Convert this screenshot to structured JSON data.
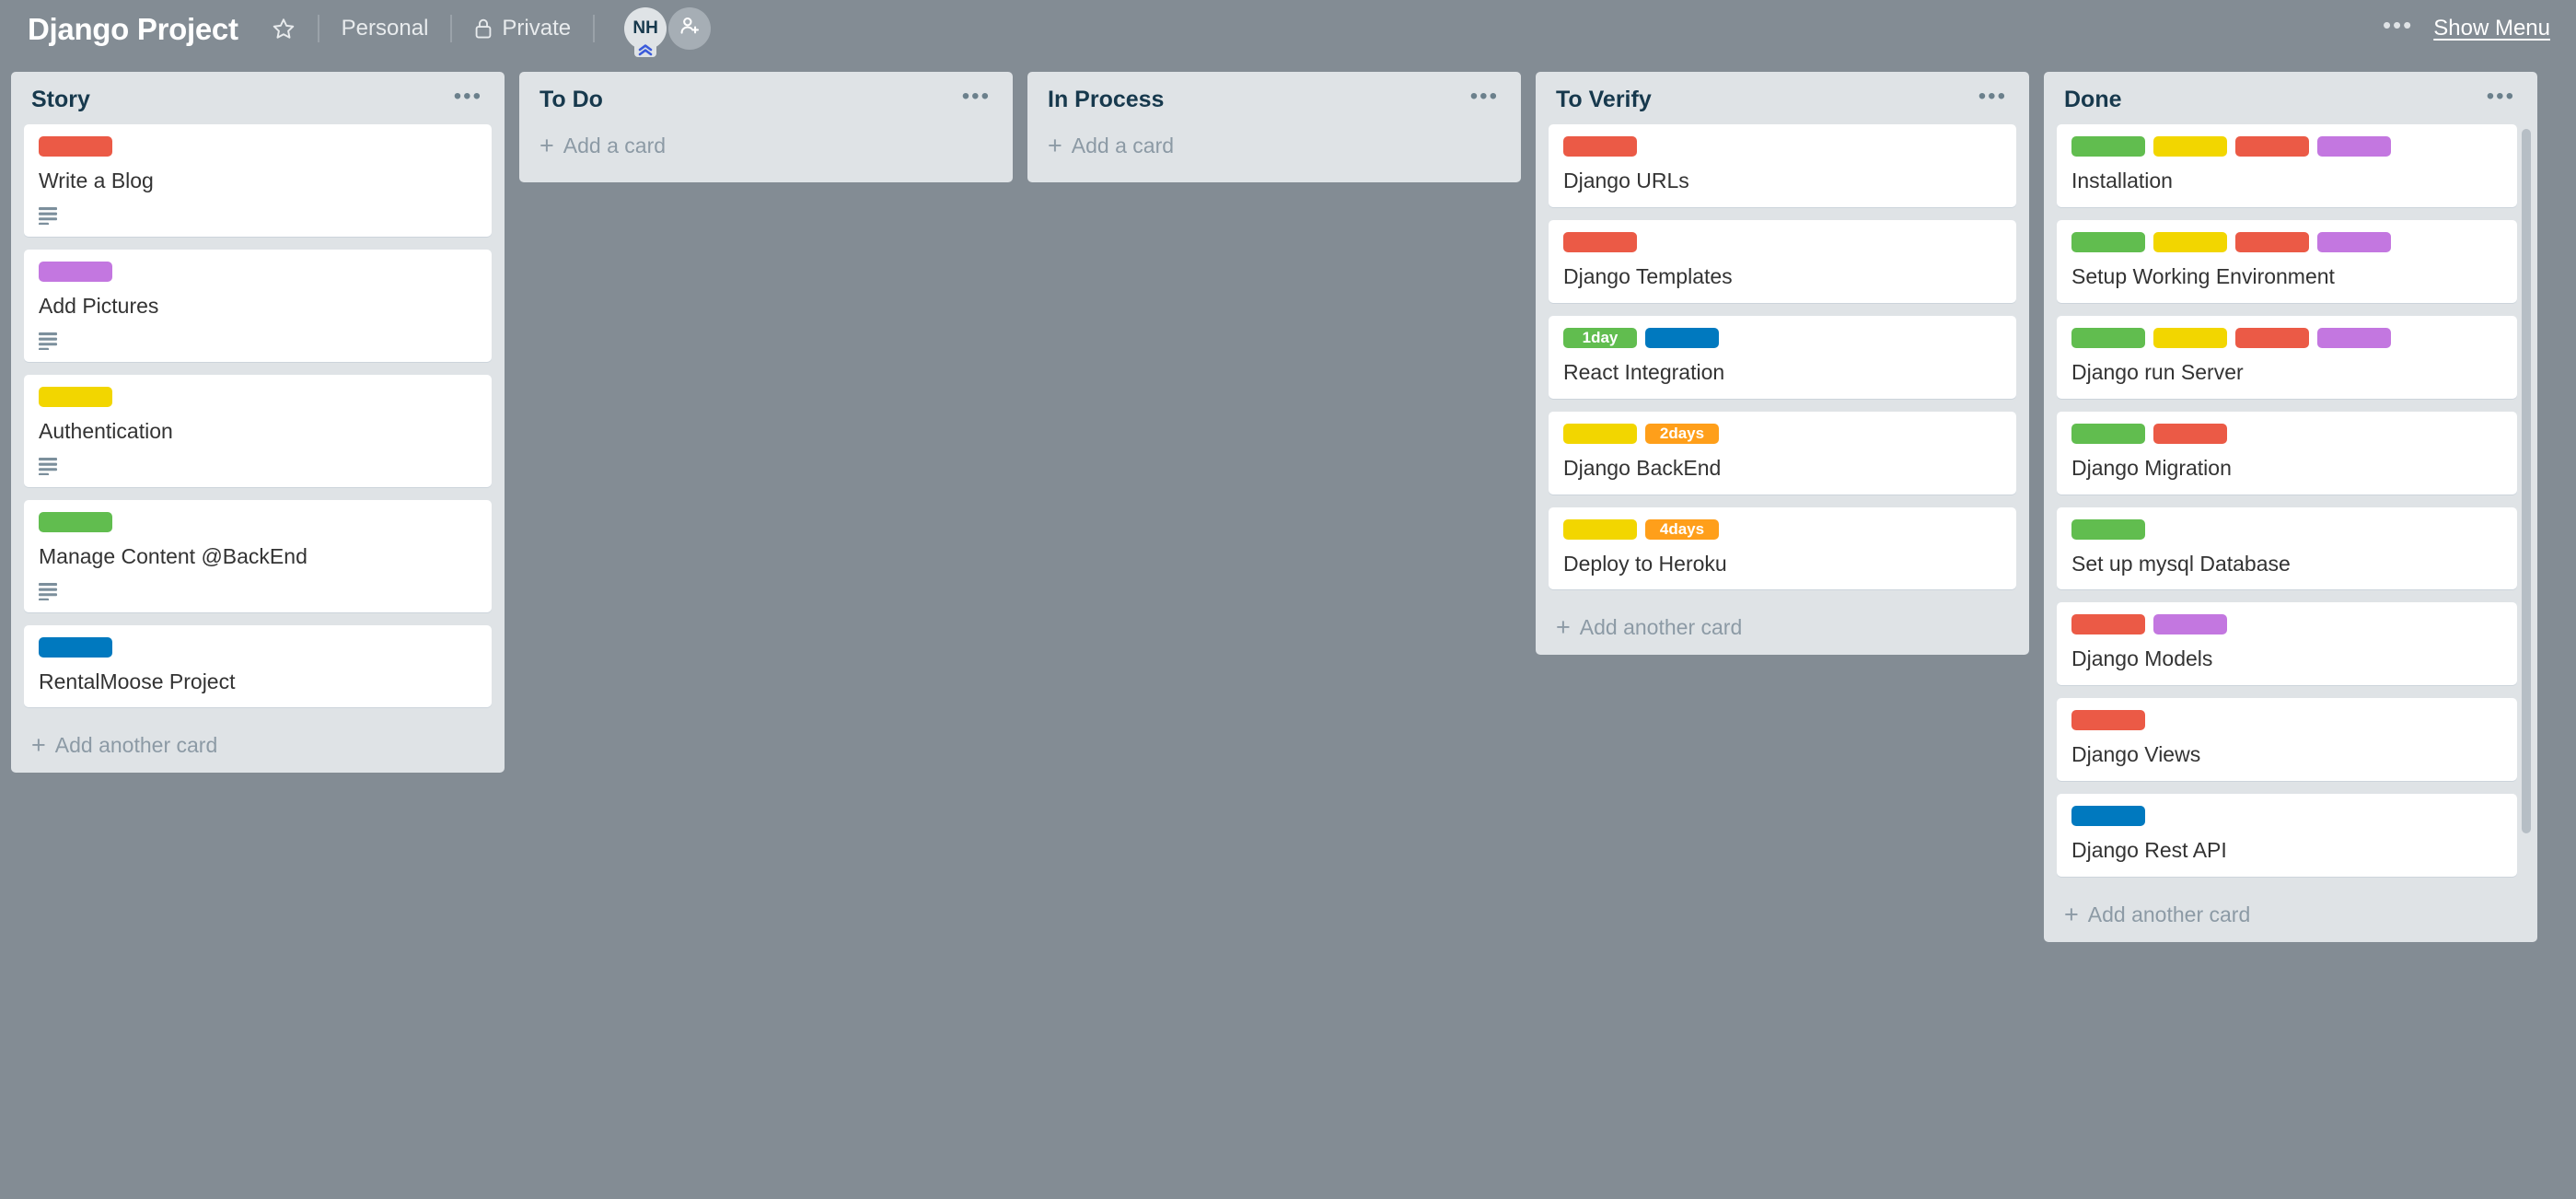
{
  "header": {
    "board_title": "Django Project",
    "star_icon": "star-icon",
    "workspace_label": "Personal",
    "visibility_label": "Private",
    "lock_icon": "lock-icon",
    "members": [
      {
        "initials": "NH",
        "type": "user-avatar"
      },
      {
        "initials": "",
        "type": "add-member-avatar"
      }
    ],
    "more_icon": "ellipsis-icon",
    "show_menu_label": "Show Menu"
  },
  "colors": {
    "board_background": "#838c94",
    "list_background": "#dfe3e6",
    "card_background": "#ffffff",
    "title_text": "#17394d",
    "label_green": "#61bd4f",
    "label_yellow": "#f2d600",
    "label_orange": "#ff9f1a",
    "label_red": "#eb5a46",
    "label_purple": "#c377e0",
    "label_blue": "#0079bf"
  },
  "lists": [
    {
      "title": "Story",
      "menu_icon": "ellipsis-icon",
      "add_label": "Add another card",
      "scrollable": false,
      "cards": [
        {
          "title": "Write a Blog",
          "has_description": true,
          "labels": [
            {
              "color": "#eb5a46",
              "text": ""
            }
          ]
        },
        {
          "title": "Add Pictures",
          "has_description": true,
          "labels": [
            {
              "color": "#c377e0",
              "text": ""
            }
          ]
        },
        {
          "title": "Authentication",
          "has_description": true,
          "labels": [
            {
              "color": "#f2d600",
              "text": ""
            }
          ]
        },
        {
          "title": "Manage Content @BackEnd",
          "has_description": true,
          "labels": [
            {
              "color": "#61bd4f",
              "text": ""
            }
          ]
        },
        {
          "title": "RentalMoose Project",
          "has_description": false,
          "labels": [
            {
              "color": "#0079bf",
              "text": ""
            }
          ]
        }
      ]
    },
    {
      "title": "To Do",
      "menu_icon": "ellipsis-icon",
      "add_label": "Add a card",
      "scrollable": false,
      "cards": []
    },
    {
      "title": "In Process",
      "menu_icon": "ellipsis-icon",
      "add_label": "Add a card",
      "scrollable": false,
      "cards": []
    },
    {
      "title": "To Verify",
      "menu_icon": "ellipsis-icon",
      "add_label": "Add another card",
      "scrollable": false,
      "cards": [
        {
          "title": "Django URLs",
          "has_description": false,
          "labels": [
            {
              "color": "#eb5a46",
              "text": ""
            }
          ]
        },
        {
          "title": "Django Templates",
          "has_description": false,
          "labels": [
            {
              "color": "#eb5a46",
              "text": ""
            }
          ]
        },
        {
          "title": "React Integration",
          "has_description": false,
          "labels": [
            {
              "color": "#61bd4f",
              "text": "1day"
            },
            {
              "color": "#0079bf",
              "text": ""
            }
          ]
        },
        {
          "title": "Django BackEnd",
          "has_description": false,
          "labels": [
            {
              "color": "#f2d600",
              "text": ""
            },
            {
              "color": "#ff9f1a",
              "text": "2days"
            }
          ]
        },
        {
          "title": "Deploy to Heroku",
          "has_description": false,
          "labels": [
            {
              "color": "#f2d600",
              "text": ""
            },
            {
              "color": "#ff9f1a",
              "text": "4days"
            }
          ]
        }
      ]
    },
    {
      "title": "Done",
      "menu_icon": "ellipsis-icon",
      "add_label": "Add another card",
      "scrollable": true,
      "cards": [
        {
          "title": "Installation",
          "has_description": false,
          "labels": [
            {
              "color": "#61bd4f",
              "text": ""
            },
            {
              "color": "#f2d600",
              "text": ""
            },
            {
              "color": "#eb5a46",
              "text": ""
            },
            {
              "color": "#c377e0",
              "text": ""
            }
          ]
        },
        {
          "title": "Setup Working Environment",
          "has_description": false,
          "labels": [
            {
              "color": "#61bd4f",
              "text": ""
            },
            {
              "color": "#f2d600",
              "text": ""
            },
            {
              "color": "#eb5a46",
              "text": ""
            },
            {
              "color": "#c377e0",
              "text": ""
            }
          ]
        },
        {
          "title": "Django run Server",
          "has_description": false,
          "labels": [
            {
              "color": "#61bd4f",
              "text": ""
            },
            {
              "color": "#f2d600",
              "text": ""
            },
            {
              "color": "#eb5a46",
              "text": ""
            },
            {
              "color": "#c377e0",
              "text": ""
            }
          ]
        },
        {
          "title": "Django Migration",
          "has_description": false,
          "labels": [
            {
              "color": "#61bd4f",
              "text": ""
            },
            {
              "color": "#eb5a46",
              "text": ""
            }
          ]
        },
        {
          "title": "Set up mysql Database",
          "has_description": false,
          "labels": [
            {
              "color": "#61bd4f",
              "text": ""
            }
          ]
        },
        {
          "title": "Django Models",
          "has_description": false,
          "labels": [
            {
              "color": "#eb5a46",
              "text": ""
            },
            {
              "color": "#c377e0",
              "text": ""
            }
          ]
        },
        {
          "title": "Django Views",
          "has_description": false,
          "labels": [
            {
              "color": "#eb5a46",
              "text": ""
            }
          ]
        },
        {
          "title": "Django Rest API",
          "has_description": false,
          "labels": [
            {
              "color": "#0079bf",
              "text": ""
            }
          ]
        }
      ]
    }
  ]
}
